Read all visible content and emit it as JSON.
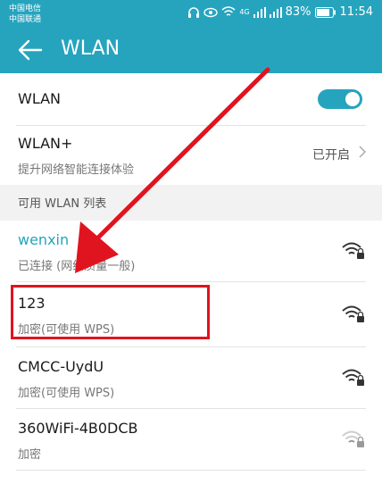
{
  "status_bar": {
    "carrier_1": "中国电信",
    "carrier_2": "中国联通",
    "signal_text": "4G",
    "battery": "83%",
    "time": "11:54"
  },
  "app_bar": {
    "title": "WLAN"
  },
  "wlan_toggle": {
    "label": "WLAN",
    "state": "on"
  },
  "wlan_plus": {
    "title": "WLAN+",
    "description": "提升网络智能连接体验",
    "status": "已开启"
  },
  "section_header": "可用 WLAN 列表",
  "networks": [
    {
      "name": "wenxin",
      "status": "已连接 (网络质量一般)",
      "icon": "wifi-lock-icon"
    },
    {
      "name": "123",
      "status": "加密(可使用 WPS)",
      "icon": "wifi-lock-icon"
    },
    {
      "name": "CMCC-UydU",
      "status": "加密(可使用 WPS)",
      "icon": "wifi-lock-icon"
    },
    {
      "name": "360WiFi-4B0DCB",
      "status": "加密",
      "icon": "wifi-lock-icon-weak"
    }
  ],
  "colors": {
    "brand": "#26a4be",
    "connected": "#26a4be",
    "highlight": "#e0141e"
  }
}
